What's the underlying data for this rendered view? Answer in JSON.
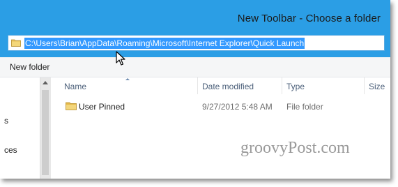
{
  "window": {
    "title": "New Toolbar - Choose a folder"
  },
  "address_bar": {
    "value": "C:\\Users\\Brian\\AppData\\Roaming\\Microsoft\\Internet Explorer\\Quick Launch",
    "selected": true,
    "icon": "folder-icon"
  },
  "toolbar": {
    "new_folder_label": "New folder"
  },
  "nav_pane": {
    "items": [
      "s",
      "ces"
    ]
  },
  "file_list": {
    "columns": [
      "Name",
      "Date modified",
      "Type",
      "Size"
    ],
    "sort_column": "Name",
    "rows": [
      {
        "name": "User Pinned",
        "date_modified": "9/27/2012 5:48 AM",
        "type": "File folder",
        "icon": "folder-icon"
      }
    ]
  },
  "watermark": {
    "text": "groovyPost.com"
  },
  "colors": {
    "titlebar": "#2b9ee5",
    "selection": "#3399ff",
    "folder": "#e8c25a"
  }
}
